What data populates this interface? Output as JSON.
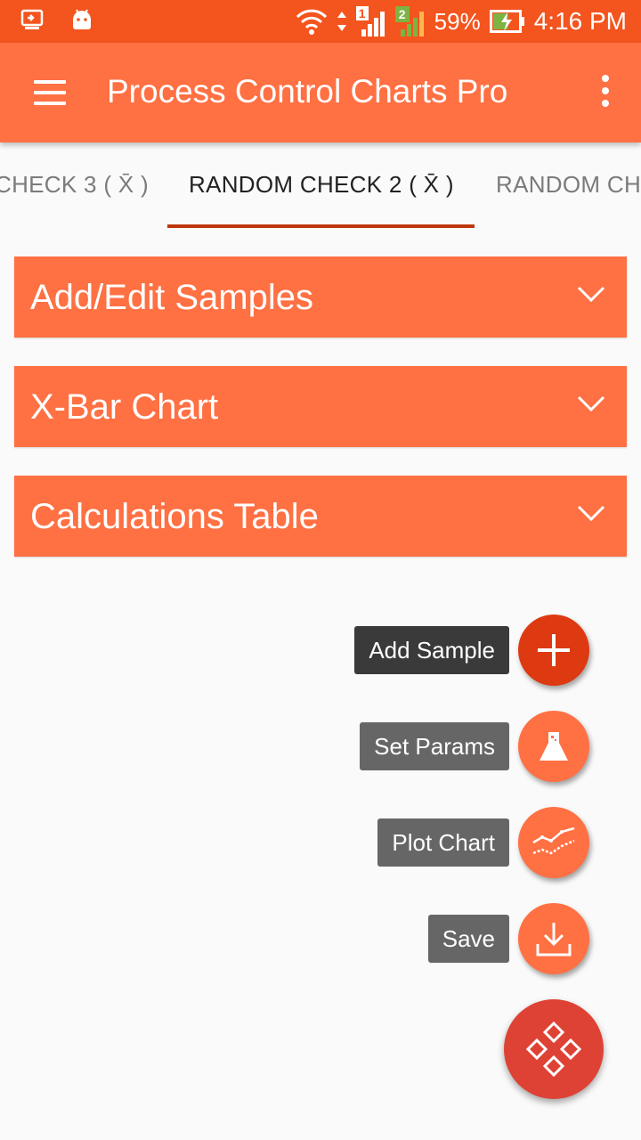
{
  "status_bar": {
    "battery": "59%",
    "time": "4:16 PM",
    "sim1": "1",
    "sim2": "2"
  },
  "app_bar": {
    "title": "Process Control Charts Pro"
  },
  "tabs": [
    {
      "label": "CHECK 3 ( X̄ )",
      "active": false
    },
    {
      "label": "RANDOM CHECK 2 ( X̄ )",
      "active": true
    },
    {
      "label": "RANDOM CH",
      "active": false
    }
  ],
  "cards": [
    {
      "title": "Add/Edit Samples"
    },
    {
      "title": "X-Bar Chart"
    },
    {
      "title": "Calculations Table"
    }
  ],
  "fab_menu": {
    "items": [
      {
        "label": "Add Sample",
        "icon": "plus-icon"
      },
      {
        "label": "Set Params",
        "icon": "flask-icon"
      },
      {
        "label": "Plot Chart",
        "icon": "line-chart-icon"
      },
      {
        "label": "Save",
        "icon": "download-icon"
      }
    ],
    "main_icon": "diamonds-icon"
  },
  "colors": {
    "status_bar": "#f4541d",
    "app_bar": "#ff7043",
    "card": "#ff7043",
    "tab_indicator": "#bf360c",
    "primary_fab": "#dd3a12",
    "main_fab": "#de4234"
  }
}
